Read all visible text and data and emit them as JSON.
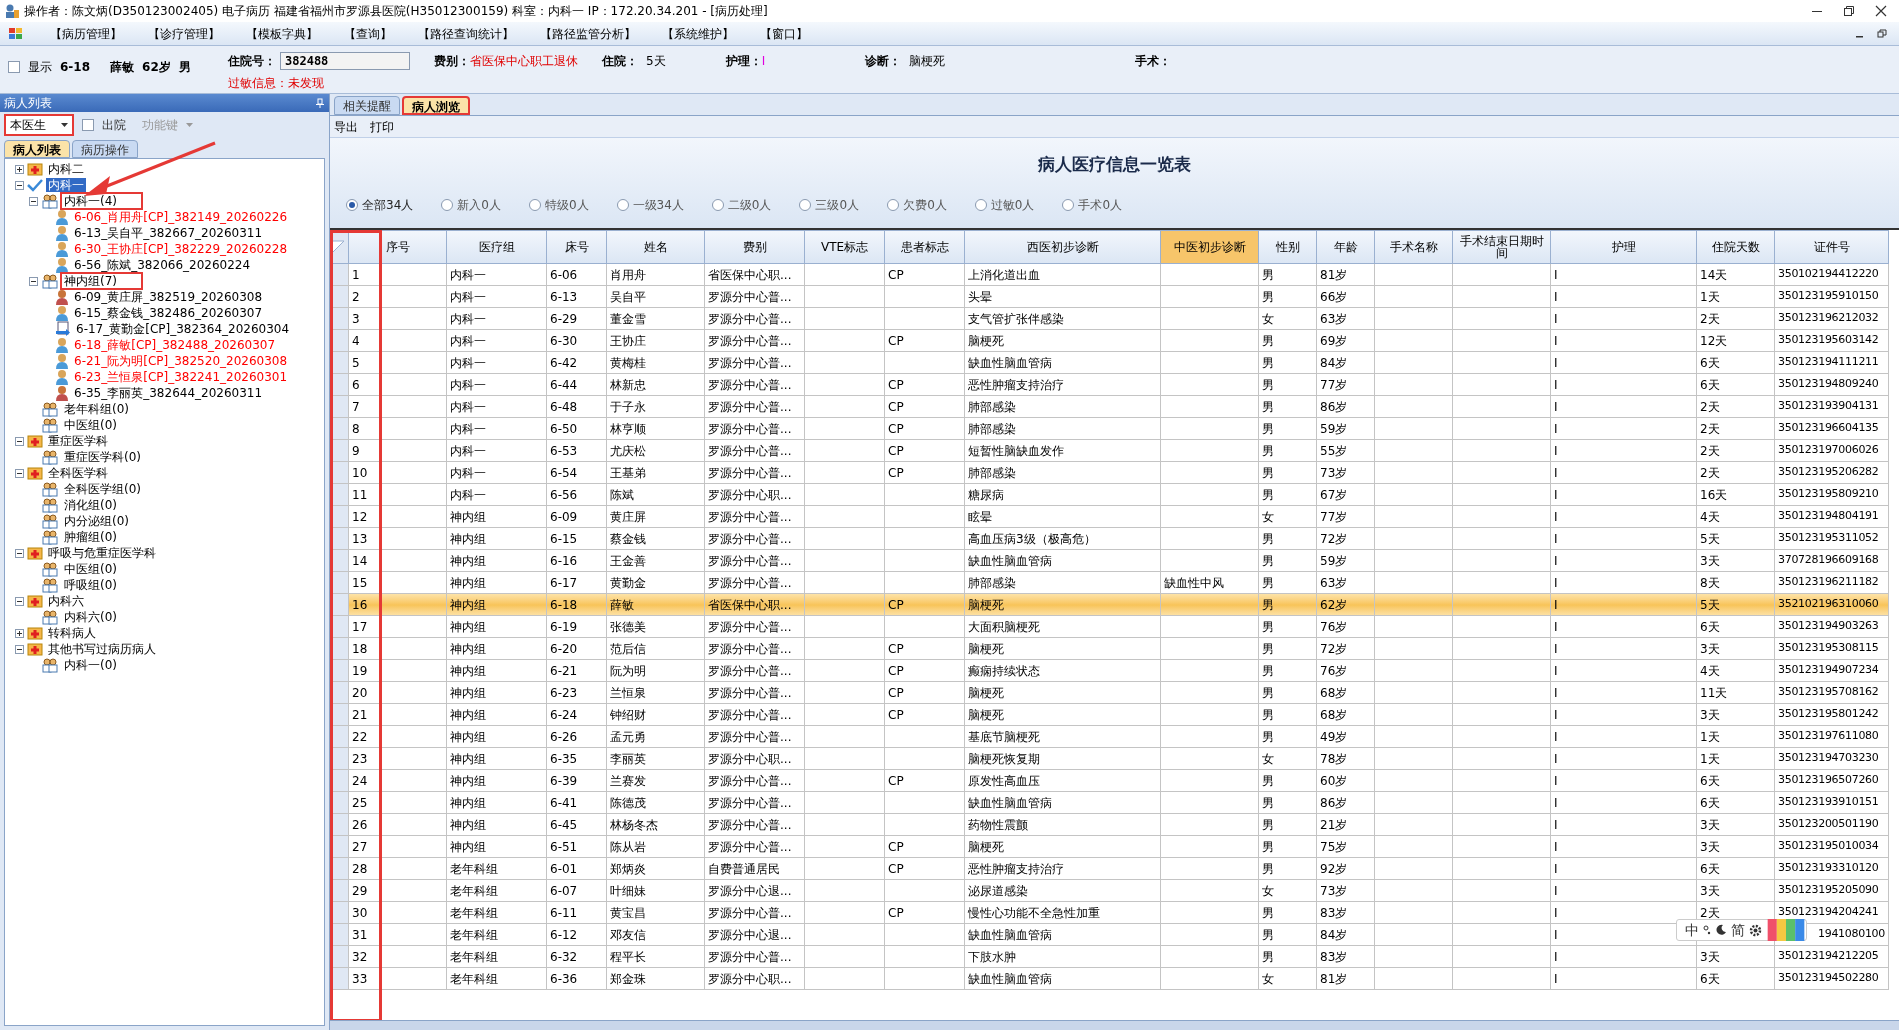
{
  "window": {
    "title": "操作者：陈文炳(D350123002405) 电子病历  福建省福州市罗源县医院(H35012300159)  科室：内科一  IP：172.20.34.201 - [病历处理]"
  },
  "menu": [
    "【病历管理】",
    "【诊疗管理】",
    "【模板字典】",
    "【查询】",
    "【路径查询统计】",
    "【路径监管分析】",
    "【系统维护】",
    "【窗口】"
  ],
  "patient_bar": {
    "show_checkbox": {
      "label": "显示",
      "checked": false
    },
    "bed": "6-18",
    "name": "薛敏",
    "age": "62岁",
    "sex": "男",
    "admission_label": "住院号：",
    "admission_value": "382488",
    "allergy_label": "过敏信息：",
    "allergy_value": "未发现",
    "fee_label": "费别：",
    "fee_value": "省医保中心职工退休",
    "stay_label": "住院：",
    "stay_value": "5天",
    "care_label": "护理：",
    "care_value": "I",
    "diagnosis_label": "诊断：",
    "diagnosis_value": "脑梗死",
    "surgery_label": "手术："
  },
  "left_panel": {
    "title": "病人列表",
    "doctor_select": "本医生",
    "discharged": {
      "label": "出院",
      "checked": false
    },
    "function_key": {
      "label": "功能键",
      "disabled": true
    },
    "tabs": [
      {
        "label": "病人列表",
        "selected": true
      },
      {
        "label": "病历操作",
        "selected": false
      }
    ],
    "tree": [
      {
        "label": "内科二",
        "kind": "dept",
        "expanded": false,
        "selected": false
      },
      {
        "label": "内科一",
        "kind": "check",
        "expanded": true,
        "selected": true,
        "children": [
          {
            "label": "内科一(4)",
            "kind": "group",
            "expanded": true,
            "selected": false,
            "marked": true,
            "children": [
              {
                "label": "6-06_肖用舟[CP]_382149_20260226",
                "kind": "male",
                "color": "#ff0000",
                "selected": false
              },
              {
                "label": "6-13_吴自平_382667_20260311",
                "kind": "male",
                "color": "#000000",
                "selected": false
              },
              {
                "label": "6-30_王协庄[CP]_382229_20260228",
                "kind": "male",
                "color": "#ff0000",
                "selected": false
              },
              {
                "label": "6-56_陈斌_382066_20260224",
                "kind": "male",
                "color": "#000000",
                "selected": false
              }
            ]
          },
          {
            "label": "神内组(7)",
            "kind": "group",
            "expanded": true,
            "selected": false,
            "marked": true,
            "children": [
              {
                "label": "6-09_黄庄屏_382519_20260308",
                "kind": "female",
                "color": "#000000",
                "selected": false
              },
              {
                "label": "6-15_蔡金钱_382486_20260307",
                "kind": "male",
                "color": "#000000",
                "selected": false
              },
              {
                "label": "6-17_黄勤金[CP]_382364_20260304",
                "kind": "transfer",
                "color": "#000000",
                "selected": false
              },
              {
                "label": "6-18_薛敏[CP]_382488_20260307",
                "kind": "male",
                "color": "#ff0000",
                "selected": false
              },
              {
                "label": "6-21_阮为明[CP]_382520_20260308",
                "kind": "male",
                "color": "#ff0000",
                "selected": false
              },
              {
                "label": "6-23_兰恒泉[CP]_382241_20260301",
                "kind": "male",
                "color": "#ff0000",
                "selected": false
              },
              {
                "label": "6-35_李丽英_382644_20260311",
                "kind": "female",
                "color": "#000000",
                "selected": false
              }
            ]
          },
          {
            "label": "老年科组(0)",
            "kind": "group",
            "selected": false
          },
          {
            "label": "中医组(0)",
            "kind": "group",
            "selected": false
          }
        ]
      },
      {
        "label": "重症医学科",
        "kind": "dept",
        "expanded": true,
        "selected": false,
        "children": [
          {
            "label": "重症医学科(0)",
            "kind": "group",
            "selected": false
          }
        ]
      },
      {
        "label": "全科医学科",
        "kind": "dept",
        "expanded": true,
        "selected": false,
        "children": [
          {
            "label": "全科医学组(0)",
            "kind": "group",
            "selected": false
          },
          {
            "label": "消化组(0)",
            "kind": "group",
            "selected": false
          },
          {
            "label": "内分泌组(0)",
            "kind": "group",
            "selected": false
          },
          {
            "label": "肿瘤组(0)",
            "kind": "group",
            "selected": false
          }
        ]
      },
      {
        "label": "呼吸与危重症医学科",
        "kind": "dept",
        "expanded": true,
        "selected": false,
        "children": [
          {
            "label": "中医组(0)",
            "kind": "group",
            "selected": false
          },
          {
            "label": "呼吸组(0)",
            "kind": "group",
            "selected": false
          }
        ]
      },
      {
        "label": "内科六",
        "kind": "dept",
        "expanded": true,
        "selected": false,
        "children": [
          {
            "label": "内科六(0)",
            "kind": "group",
            "selected": false
          }
        ]
      },
      {
        "label": "转科病人",
        "kind": "dept",
        "expanded": false,
        "selected": false
      },
      {
        "label": "其他书写过病历病人",
        "kind": "dept",
        "expanded": true,
        "selected": false,
        "children": [
          {
            "label": "内科一(0)",
            "kind": "group",
            "selected": false
          }
        ]
      }
    ]
  },
  "main_tabs": [
    {
      "label": "相关提醒",
      "selected": false
    },
    {
      "label": "病人浏览",
      "selected": true
    }
  ],
  "toolbar": [
    "导出",
    "打印"
  ],
  "report_title": "病人医疗信息一览表",
  "filters": [
    {
      "label": "全部34人",
      "selected": true
    },
    {
      "label": "新入0人",
      "selected": false
    },
    {
      "label": "特级0人",
      "selected": false
    },
    {
      "label": "一级34人",
      "selected": false
    },
    {
      "label": "二级0人",
      "selected": false
    },
    {
      "label": "三级0人",
      "selected": false
    },
    {
      "label": "欠费0人",
      "selected": false
    },
    {
      "label": "过敏0人",
      "selected": false
    },
    {
      "label": "手术0人",
      "selected": false
    }
  ],
  "table": {
    "columns": [
      {
        "label": "序号",
        "selected": false
      },
      {
        "label": "医疗组",
        "selected": false
      },
      {
        "label": "床号",
        "selected": false
      },
      {
        "label": "姓名",
        "selected": false
      },
      {
        "label": "费别",
        "selected": false
      },
      {
        "label": "VTE标志",
        "selected": false
      },
      {
        "label": "患者标志",
        "selected": false
      },
      {
        "label": "西医初步诊断",
        "selected": false
      },
      {
        "label": "中医初步诊断",
        "selected": true
      },
      {
        "label": "性别",
        "selected": false
      },
      {
        "label": "年龄",
        "selected": false
      },
      {
        "label": "手术名称",
        "selected": false
      },
      {
        "label": "手术结束日期时间",
        "selected": false
      },
      {
        "label": "护理",
        "selected": false
      },
      {
        "label": "住院天数",
        "selected": false
      },
      {
        "label": "证件号",
        "selected": false
      }
    ],
    "rows": [
      {
        "selected": false,
        "cells": [
          "1",
          "内科一",
          "6-06",
          "肖用舟",
          "省医保中心职...",
          null,
          "CP",
          "上消化道出血",
          null,
          "男",
          "81岁",
          null,
          null,
          "I",
          "14天",
          "350102194412220"
        ]
      },
      {
        "selected": false,
        "cells": [
          "2",
          "内科一",
          "6-13",
          "吴自平",
          "罗源分中心普...",
          null,
          null,
          "头晕",
          null,
          "男",
          "66岁",
          null,
          null,
          "I",
          "1天",
          "350123195910150"
        ]
      },
      {
        "selected": false,
        "cells": [
          "3",
          "内科一",
          "6-29",
          "董金雪",
          "罗源分中心普...",
          null,
          null,
          "支气管扩张伴感染",
          null,
          "女",
          "63岁",
          null,
          null,
          "I",
          "2天",
          "350123196212032"
        ]
      },
      {
        "selected": false,
        "cells": [
          "4",
          "内科一",
          "6-30",
          "王协庄",
          "罗源分中心普...",
          null,
          "CP",
          "脑梗死",
          null,
          "男",
          "69岁",
          null,
          null,
          "I",
          "12天",
          "350123195603142"
        ]
      },
      {
        "selected": false,
        "cells": [
          "5",
          "内科一",
          "6-42",
          "黄梅桂",
          "罗源分中心普...",
          null,
          null,
          "缺血性脑血管病",
          null,
          "男",
          "84岁",
          null,
          null,
          "I",
          "6天",
          "350123194111211"
        ]
      },
      {
        "selected": false,
        "cells": [
          "6",
          "内科一",
          "6-44",
          "林新忠",
          "罗源分中心普...",
          null,
          "CP",
          "恶性肿瘤支持治疗",
          null,
          "男",
          "77岁",
          null,
          null,
          "I",
          "6天",
          "350123194809240"
        ]
      },
      {
        "selected": false,
        "cells": [
          "7",
          "内科一",
          "6-48",
          "于子永",
          "罗源分中心普...",
          null,
          "CP",
          "肺部感染",
          null,
          "男",
          "86岁",
          null,
          null,
          "I",
          "2天",
          "350123193904131"
        ]
      },
      {
        "selected": false,
        "cells": [
          "8",
          "内科一",
          "6-50",
          "林亨顺",
          "罗源分中心普...",
          null,
          "CP",
          "肺部感染",
          null,
          "男",
          "59岁",
          null,
          null,
          "I",
          "2天",
          "350123196604135"
        ]
      },
      {
        "selected": false,
        "cells": [
          "9",
          "内科一",
          "6-53",
          "尤庆松",
          "罗源分中心普...",
          null,
          "CP",
          "短暂性脑缺血发作",
          null,
          "男",
          "55岁",
          null,
          null,
          "I",
          "2天",
          "350123197006026"
        ]
      },
      {
        "selected": false,
        "cells": [
          "10",
          "内科一",
          "6-54",
          "王基弟",
          "罗源分中心普...",
          null,
          "CP",
          "肺部感染",
          null,
          "男",
          "73岁",
          null,
          null,
          "I",
          "2天",
          "350123195206282"
        ]
      },
      {
        "selected": false,
        "cells": [
          "11",
          "内科一",
          "6-56",
          "陈斌",
          "罗源分中心职...",
          null,
          null,
          "糖尿病",
          null,
          "男",
          "67岁",
          null,
          null,
          "I",
          "16天",
          "350123195809210"
        ]
      },
      {
        "selected": false,
        "cells": [
          "12",
          "神内组",
          "6-09",
          "黄庄屏",
          "罗源分中心普...",
          null,
          null,
          "眩晕",
          null,
          "女",
          "77岁",
          null,
          null,
          "I",
          "4天",
          "350123194804191"
        ]
      },
      {
        "selected": false,
        "cells": [
          "13",
          "神内组",
          "6-15",
          "蔡金钱",
          "罗源分中心普...",
          null,
          null,
          "高血压病3级（极高危）",
          null,
          "男",
          "72岁",
          null,
          null,
          "I",
          "5天",
          "350123195311052"
        ]
      },
      {
        "selected": false,
        "cells": [
          "14",
          "神内组",
          "6-16",
          "王金善",
          "罗源分中心普...",
          null,
          null,
          "缺血性脑血管病",
          null,
          "男",
          "59岁",
          null,
          null,
          "I",
          "3天",
          "370728196609168"
        ]
      },
      {
        "selected": false,
        "cells": [
          "15",
          "神内组",
          "6-17",
          "黄勤金",
          "罗源分中心普...",
          null,
          null,
          "肺部感染",
          "缺血性中风",
          "男",
          "63岁",
          null,
          null,
          "I",
          "8天",
          "350123196211182"
        ]
      },
      {
        "selected": true,
        "cells": [
          "16",
          "神内组",
          "6-18",
          "薛敏",
          "省医保中心职...",
          null,
          "CP",
          "脑梗死",
          null,
          "男",
          "62岁",
          null,
          null,
          "I",
          "5天",
          "352102196310060"
        ]
      },
      {
        "selected": false,
        "cells": [
          "17",
          "神内组",
          "6-19",
          "张德美",
          "罗源分中心普...",
          null,
          null,
          "大面积脑梗死",
          null,
          "男",
          "76岁",
          null,
          null,
          "I",
          "6天",
          "350123194903263"
        ]
      },
      {
        "selected": false,
        "cells": [
          "18",
          "神内组",
          "6-20",
          "范后信",
          "罗源分中心普...",
          null,
          "CP",
          "脑梗死",
          null,
          "男",
          "72岁",
          null,
          null,
          "I",
          "3天",
          "350123195308115"
        ]
      },
      {
        "selected": false,
        "cells": [
          "19",
          "神内组",
          "6-21",
          "阮为明",
          "罗源分中心普...",
          null,
          "CP",
          "癫痫持续状态",
          null,
          "男",
          "76岁",
          null,
          null,
          "I",
          "4天",
          "350123194907234"
        ]
      },
      {
        "selected": false,
        "cells": [
          "20",
          "神内组",
          "6-23",
          "兰恒泉",
          "罗源分中心普...",
          null,
          "CP",
          "脑梗死",
          null,
          "男",
          "68岁",
          null,
          null,
          "I",
          "11天",
          "350123195708162"
        ]
      },
      {
        "selected": false,
        "cells": [
          "21",
          "神内组",
          "6-24",
          "钟绍财",
          "罗源分中心普...",
          null,
          "CP",
          "脑梗死",
          null,
          "男",
          "68岁",
          null,
          null,
          "I",
          "3天",
          "350123195801242"
        ]
      },
      {
        "selected": false,
        "cells": [
          "22",
          "神内组",
          "6-26",
          "孟元勇",
          "罗源分中心普...",
          null,
          null,
          "基底节脑梗死",
          null,
          "男",
          "49岁",
          null,
          null,
          "I",
          "1天",
          "350123197611080"
        ]
      },
      {
        "selected": false,
        "cells": [
          "23",
          "神内组",
          "6-35",
          "李丽英",
          "罗源分中心职...",
          null,
          null,
          "脑梗死恢复期",
          null,
          "女",
          "78岁",
          null,
          null,
          "I",
          "1天",
          "350123194703230"
        ]
      },
      {
        "selected": false,
        "cells": [
          "24",
          "神内组",
          "6-39",
          "兰赛发",
          "罗源分中心普...",
          null,
          "CP",
          "原发性高血压",
          null,
          "男",
          "60岁",
          null,
          null,
          "I",
          "6天",
          "350123196507260"
        ]
      },
      {
        "selected": false,
        "cells": [
          "25",
          "神内组",
          "6-41",
          "陈德茂",
          "罗源分中心普...",
          null,
          null,
          "缺血性脑血管病",
          null,
          "男",
          "86岁",
          null,
          null,
          "I",
          "6天",
          "350123193910151"
        ]
      },
      {
        "selected": false,
        "cells": [
          "26",
          "神内组",
          "6-45",
          "林杨冬杰",
          "罗源分中心普...",
          null,
          null,
          "药物性震颤",
          null,
          "男",
          "21岁",
          null,
          null,
          "I",
          "3天",
          "350123200501190"
        ]
      },
      {
        "selected": false,
        "cells": [
          "27",
          "神内组",
          "6-51",
          "陈从岩",
          "罗源分中心普...",
          null,
          "CP",
          "脑梗死",
          null,
          "男",
          "75岁",
          null,
          null,
          "I",
          "3天",
          "350123195010034"
        ]
      },
      {
        "selected": false,
        "cells": [
          "28",
          "老年科组",
          "6-01",
          "郑炳炎",
          "自费普通居民",
          null,
          "CP",
          "恶性肿瘤支持治疗",
          null,
          "男",
          "92岁",
          null,
          null,
          "I",
          "6天",
          "350123193310120"
        ]
      },
      {
        "selected": false,
        "cells": [
          "29",
          "老年科组",
          "6-07",
          "叶细妹",
          "罗源分中心退...",
          null,
          null,
          "泌尿道感染",
          null,
          "女",
          "73岁",
          null,
          null,
          "I",
          "3天",
          "350123195205090"
        ]
      },
      {
        "selected": false,
        "cells": [
          "30",
          "老年科组",
          "6-11",
          "黄宝昌",
          "罗源分中心普...",
          null,
          "CP",
          "慢性心功能不全急性加重",
          null,
          "男",
          "83岁",
          null,
          null,
          "I",
          "2天",
          "350123194204241"
        ]
      },
      {
        "selected": false,
        "cells": [
          "31",
          "老年科组",
          "6-12",
          "邓友信",
          "罗源分中心退...",
          null,
          null,
          "缺血性脑血管病",
          null,
          "男",
          "84岁",
          null,
          null,
          "I",
          null,
          "1941080100"
        ]
      },
      {
        "selected": false,
        "cells": [
          "32",
          "老年科组",
          "6-32",
          "程平长",
          "罗源分中心普...",
          null,
          null,
          "下肢水肿",
          null,
          "男",
          "83岁",
          null,
          null,
          "I",
          "3天",
          "350123194212205"
        ]
      },
      {
        "selected": false,
        "cells": [
          "33",
          "老年科组",
          "6-36",
          "郑金珠",
          "罗源分中心职...",
          null,
          null,
          "缺血性脑血管病",
          null,
          "女",
          "81岁",
          null,
          null,
          "I",
          "6天",
          "350123194502280"
        ]
      }
    ]
  },
  "ime_toolbar": [
    "中",
    "简"
  ]
}
